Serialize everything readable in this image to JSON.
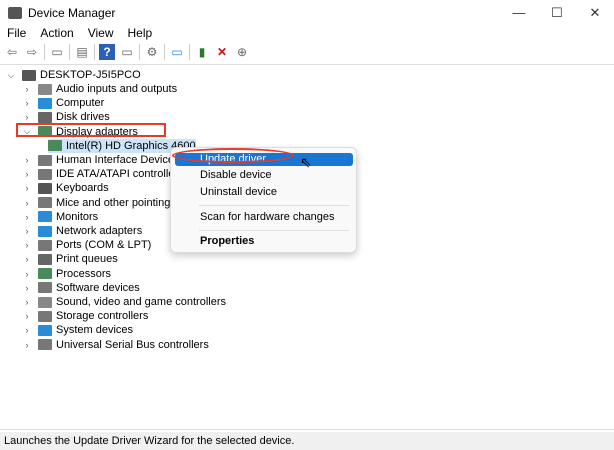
{
  "window": {
    "title": "Device Manager",
    "controls": [
      "—",
      "☐",
      "✕"
    ]
  },
  "menu": [
    "File",
    "Action",
    "View",
    "Help"
  ],
  "toolbar": [
    "back-icon",
    "forward-icon",
    "properties-icon",
    "show-hide-icon",
    "help-icon",
    "view-icon",
    "scan-icon",
    "monitor-icon",
    "update-driver-icon",
    "uninstall-icon",
    "disable-icon"
  ],
  "tree": {
    "root": "DESKTOP-J5I5PCO",
    "items": [
      {
        "label": "Audio inputs and outputs",
        "color": "#888888"
      },
      {
        "label": "Computer",
        "color": "#2a8bd6"
      },
      {
        "label": "Disk drives",
        "color": "#666666"
      },
      {
        "label": "Display adapters",
        "color": "#4a8a5a",
        "expanded": true
      },
      {
        "label": "Intel(R) HD Graphics 4600",
        "color": "#4a8a5a",
        "child": true
      },
      {
        "label": "Human Interface Devices",
        "color": "#777777"
      },
      {
        "label": "IDE ATA/ATAPI controllers",
        "color": "#777777"
      },
      {
        "label": "Keyboards",
        "color": "#555555"
      },
      {
        "label": "Mice and other pointing devices",
        "color": "#777777"
      },
      {
        "label": "Monitors",
        "color": "#2a8bd6"
      },
      {
        "label": "Network adapters",
        "color": "#2a8bd6"
      },
      {
        "label": "Ports (COM & LPT)",
        "color": "#777777"
      },
      {
        "label": "Print queues",
        "color": "#666666"
      },
      {
        "label": "Processors",
        "color": "#4a8a5a"
      },
      {
        "label": "Software devices",
        "color": "#777777"
      },
      {
        "label": "Sound, video and game controllers",
        "color": "#888888"
      },
      {
        "label": "Storage controllers",
        "color": "#777777"
      },
      {
        "label": "System devices",
        "color": "#2a8bd6"
      },
      {
        "label": "Universal Serial Bus controllers",
        "color": "#777777"
      }
    ]
  },
  "context_menu": {
    "items": [
      "Update driver",
      "Disable device",
      "Uninstall device",
      "Scan for hardware changes",
      "Properties"
    ]
  },
  "status": "Launches the Update Driver Wizard for the selected device."
}
